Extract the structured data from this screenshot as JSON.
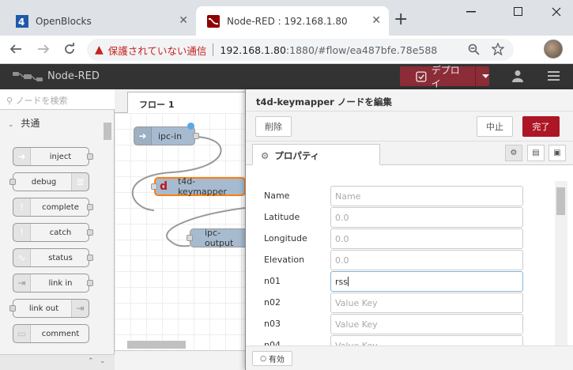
{
  "browser": {
    "tabs": [
      {
        "title": "OpenBlocks",
        "active": false
      },
      {
        "title": "Node-RED : 192.168.1.80",
        "active": true
      }
    ],
    "new_tab": "+",
    "close_glyph": "✕",
    "address": {
      "security_text": "保護されていない通信",
      "host": "192.168.1.80",
      "path": ":1880/#flow/ea487bfe.78e588"
    }
  },
  "nodered": {
    "app_title": "Node-RED",
    "deploy_label": "デプロイ",
    "palette": {
      "search_placeholder": "ノードを検索",
      "category": "共通",
      "nodes": [
        {
          "label": "inject",
          "color": "#a6bbcf"
        },
        {
          "label": "debug",
          "color": "#87a980"
        },
        {
          "label": "complete",
          "color": "#c0edc0"
        },
        {
          "label": "catch",
          "color": "#e49191"
        },
        {
          "label": "status",
          "color": "#94c1d0"
        },
        {
          "label": "link in",
          "color": "#dddddd"
        },
        {
          "label": "link out",
          "color": "#dddddd"
        },
        {
          "label": "comment",
          "color": "#ffffff"
        }
      ]
    },
    "workspace": {
      "flow_tab": "フロー 1",
      "nodes": [
        {
          "label": "ipc-in",
          "color": "#a6bbcf"
        },
        {
          "label": "t4d-keymapper",
          "color": "#a6bbcf"
        },
        {
          "label": "ipc-output",
          "color": "#a6bbcf"
        }
      ]
    },
    "editor": {
      "title": "t4d-keymapper ノードを編集",
      "delete_label": "削除",
      "cancel_label": "中止",
      "done_label": "完了",
      "properties_tab": "プロパティ",
      "fields": [
        {
          "label": "Name",
          "value": "",
          "placeholder": "Name"
        },
        {
          "label": "Latitude",
          "value": "",
          "placeholder": "0.0"
        },
        {
          "label": "Longitude",
          "value": "",
          "placeholder": "0.0"
        },
        {
          "label": "Elevation",
          "value": "",
          "placeholder": "0.0"
        },
        {
          "label": "n01",
          "value": "rss",
          "placeholder": ""
        },
        {
          "label": "n02",
          "value": "",
          "placeholder": "Value Key"
        },
        {
          "label": "n03",
          "value": "",
          "placeholder": "Value Key"
        },
        {
          "label": "n04",
          "value": "",
          "placeholder": "Value Key"
        }
      ],
      "enable_label": "有効"
    }
  },
  "colors": {
    "deploy_bg": "#8c2c37",
    "done_bg": "#ad1625",
    "header_bg": "#333333",
    "selected_node_border": "#ff7f0e"
  }
}
